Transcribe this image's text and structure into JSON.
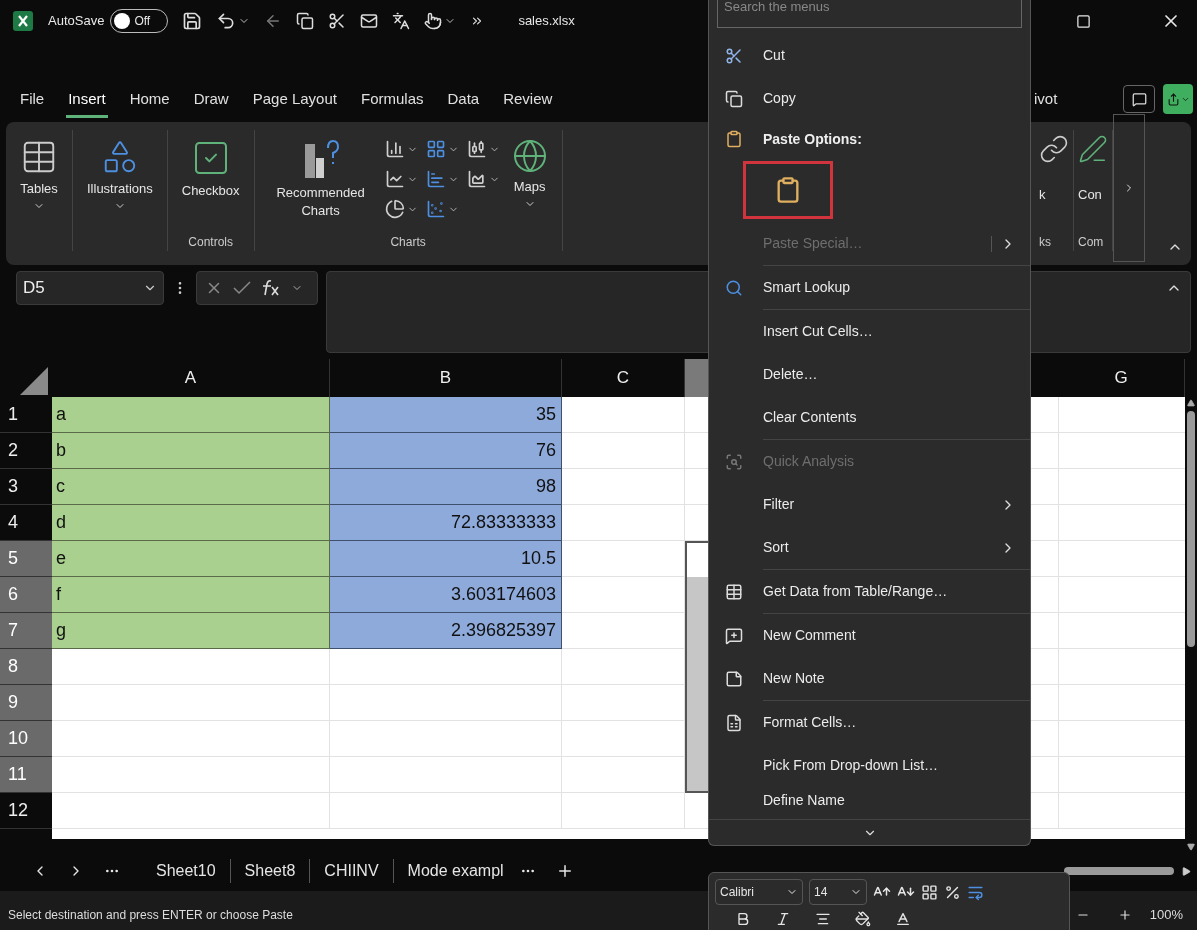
{
  "title_bar": {
    "autosave": {
      "label": "AutoSave",
      "on": false,
      "state_text": "Off"
    },
    "file_name": "sales.xlsx"
  },
  "ribbon_tabs": [
    {
      "label": "File",
      "selected": false
    },
    {
      "label": "Insert",
      "selected": true
    },
    {
      "label": "Home",
      "selected": false
    },
    {
      "label": "Draw",
      "selected": false
    },
    {
      "label": "Page Layout",
      "selected": false
    },
    {
      "label": "Formulas",
      "selected": false
    },
    {
      "label": "Data",
      "selected": false
    },
    {
      "label": "Review",
      "selected": false
    },
    {
      "label": "ivot",
      "selected": false
    }
  ],
  "ribbon": {
    "groups": [
      {
        "buttons": [
          {
            "kind": "tables",
            "label": "Tables",
            "dropdown": true
          }
        ]
      },
      {
        "buttons": [
          {
            "kind": "illustrations",
            "label": "Illustrations",
            "dropdown": true
          }
        ]
      },
      {
        "label": "Controls",
        "buttons": [
          {
            "kind": "checkbox",
            "label": "Checkbox",
            "dropdown": false
          }
        ]
      },
      {
        "label": "Charts",
        "buttons": [
          {
            "kind": "recommended",
            "label": "Recommended Charts",
            "dropdown": false
          },
          {
            "kind": "gallery"
          },
          {
            "kind": "maps",
            "label": "Maps",
            "dropdown": true
          }
        ]
      }
    ],
    "right_groups": [
      {
        "label": "ks",
        "buttons": [
          {
            "kind": "link",
            "label": "k"
          }
        ]
      },
      {
        "label": "Com",
        "buttons": [
          {
            "kind": "comment",
            "label": "Con"
          }
        ]
      }
    ]
  },
  "formula_bar": {
    "name_box": "D5"
  },
  "sheet": {
    "columns": [
      {
        "label": "A",
        "selected": false
      },
      {
        "label": "B",
        "selected": false
      },
      {
        "label": "C",
        "selected": false
      },
      {
        "selected": true
      },
      {
        "label": "G",
        "selected": false
      }
    ],
    "rows": [
      {
        "label": "1",
        "selected": false,
        "active": false,
        "a": "a",
        "b": "35"
      },
      {
        "label": "2",
        "selected": false,
        "active": false,
        "a": "b",
        "b": "76"
      },
      {
        "label": "3",
        "selected": false,
        "active": false,
        "a": "c",
        "b": "98"
      },
      {
        "label": "4",
        "selected": false,
        "active": false,
        "a": "d",
        "b": "72.83333333"
      },
      {
        "label": "5",
        "selected": true,
        "active": true,
        "a": "e",
        "b": "10.5"
      },
      {
        "label": "6",
        "selected": true,
        "active": false,
        "a": "f",
        "b": "3.603174603"
      },
      {
        "label": "7",
        "selected": true,
        "active": false,
        "a": "g",
        "b": "2.396825397"
      },
      {
        "label": "8",
        "selected": true,
        "active": false
      },
      {
        "label": "9",
        "selected": true,
        "active": false
      },
      {
        "label": "10",
        "selected": true,
        "active": false
      },
      {
        "label": "11",
        "selected": true,
        "active": false
      },
      {
        "label": "12",
        "selected": false,
        "active": false
      }
    ]
  },
  "context_menu": {
    "search_placeholder": "Search the menus",
    "items": [
      {
        "kind": "cut",
        "label": "Cut",
        "disabled": false,
        "submenu": false
      },
      {
        "kind": "copy",
        "label": "Copy",
        "disabled": false,
        "submenu": false
      },
      {
        "kind": "header",
        "label": "Paste Options:"
      },
      {
        "kind": "paste_options",
        "highlighted": true
      },
      {
        "kind": "text",
        "label": "Paste Special…",
        "disabled": true,
        "submenu": true
      },
      {
        "kind": "separator"
      },
      {
        "kind": "lookup",
        "label": "Smart Lookup",
        "disabled": false,
        "submenu": false
      },
      {
        "kind": "separator"
      },
      {
        "kind": "text",
        "label": "Insert Cut Cells…",
        "disabled": false,
        "submenu": false
      },
      {
        "kind": "text",
        "label": "Delete…",
        "disabled": false,
        "submenu": false
      },
      {
        "kind": "text",
        "label": "Clear Contents",
        "disabled": false,
        "submenu": false
      },
      {
        "kind": "separator"
      },
      {
        "kind": "quick",
        "label": "Quick Analysis",
        "disabled": true,
        "submenu": false
      },
      {
        "kind": "text",
        "label": "Filter",
        "disabled": false,
        "submenu": true
      },
      {
        "kind": "text",
        "label": "Sort",
        "disabled": false,
        "submenu": true
      },
      {
        "kind": "separator"
      },
      {
        "kind": "table",
        "label": "Get Data from Table/Range…",
        "disabled": false,
        "submenu": false
      },
      {
        "kind": "separator"
      },
      {
        "kind": "comment",
        "label": "New Comment",
        "disabled": false,
        "submenu": false
      },
      {
        "kind": "note",
        "label": "New Note",
        "disabled": false,
        "submenu": false
      },
      {
        "kind": "separator"
      },
      {
        "kind": "format",
        "label": "Format Cells…",
        "disabled": false,
        "submenu": false
      },
      {
        "kind": "text",
        "label": "Pick From Drop-down List…",
        "disabled": false,
        "submenu": false
      },
      {
        "kind": "text",
        "label": "Define Name",
        "disabled": false,
        "submenu": false,
        "cut": true
      }
    ]
  },
  "sheet_tabs": [
    "Sheet10",
    "Sheet8",
    "CHIINV",
    "Mode exampl"
  ],
  "mini_toolbar": {
    "font": "Calibri",
    "size": "14"
  },
  "status_bar": {
    "message": "Select destination and press ENTER or choose Paste",
    "zoom": "100%"
  }
}
